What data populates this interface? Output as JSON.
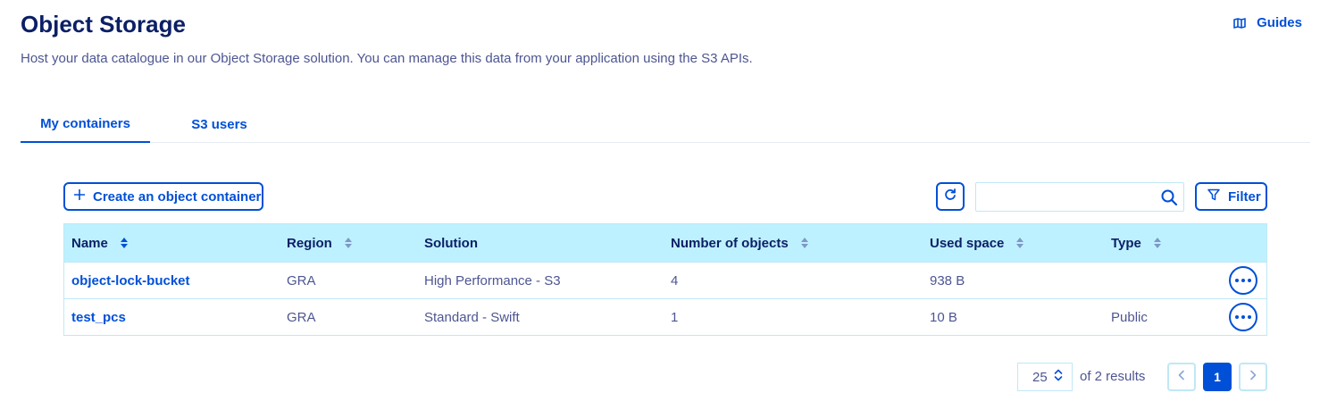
{
  "header": {
    "title": "Object Storage",
    "subtitle": "Host your data catalogue in our Object Storage solution. You can manage this data from your application using the S3 APIs.",
    "guides_label": "Guides",
    "guides_icon": "map-icon"
  },
  "tabs": [
    {
      "label": "My containers",
      "active": true
    },
    {
      "label": "S3 users",
      "active": false
    }
  ],
  "toolbar": {
    "create_label": "Create an object container",
    "create_icon": "plus-icon",
    "refresh_icon": "refresh-icon",
    "search_value": "",
    "search_placeholder": "",
    "search_icon": "search-icon",
    "filter_label": "Filter",
    "filter_icon": "funnel-icon"
  },
  "table": {
    "columns": [
      "Name",
      "Region",
      "Solution",
      "Number of objects",
      "Used space",
      "Type"
    ],
    "sorted_column": "Name",
    "rows": [
      {
        "name": "object-lock-bucket",
        "region": "GRA",
        "solution": "High Performance - S3",
        "objects": "4",
        "space": "938 B",
        "type": ""
      },
      {
        "name": "test_pcs",
        "region": "GRA",
        "solution": "Standard - Swift",
        "objects": "1",
        "space": "10 B",
        "type": "Public"
      }
    ],
    "row_action_icon": "more-horizontal-icon"
  },
  "pagination": {
    "page_size": "25",
    "results_text": "of 2 results",
    "current_page": "1"
  },
  "colors": {
    "accent": "#0050d7",
    "heading": "#0b1f66",
    "table_header_bg": "#bef1ff",
    "border": "#bfe8f6",
    "text": "#4d5592"
  }
}
